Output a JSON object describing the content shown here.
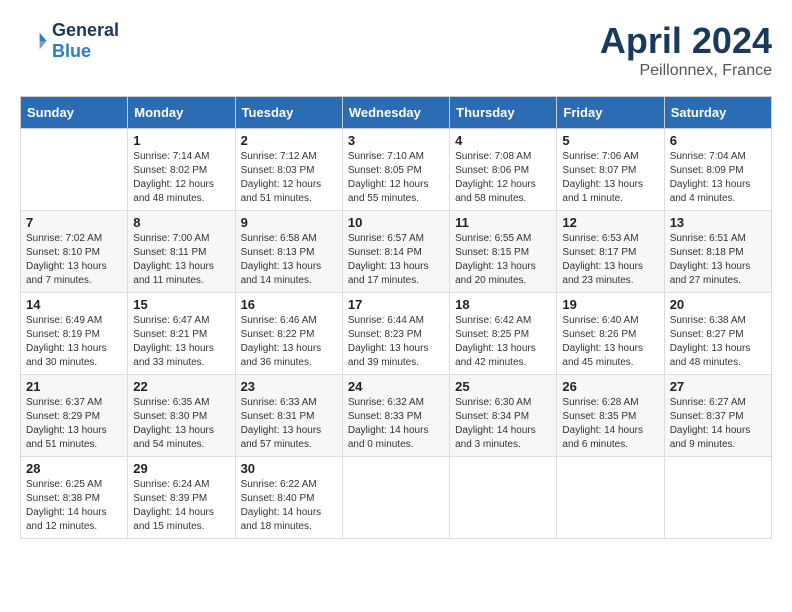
{
  "header": {
    "logo_line1": "General",
    "logo_line2": "Blue",
    "month_title": "April 2024",
    "location": "Peillonnex, France"
  },
  "days_of_week": [
    "Sunday",
    "Monday",
    "Tuesday",
    "Wednesday",
    "Thursday",
    "Friday",
    "Saturday"
  ],
  "weeks": [
    [
      {
        "day": "",
        "sunrise": "",
        "sunset": "",
        "daylight": ""
      },
      {
        "day": "1",
        "sunrise": "Sunrise: 7:14 AM",
        "sunset": "Sunset: 8:02 PM",
        "daylight": "Daylight: 12 hours and 48 minutes."
      },
      {
        "day": "2",
        "sunrise": "Sunrise: 7:12 AM",
        "sunset": "Sunset: 8:03 PM",
        "daylight": "Daylight: 12 hours and 51 minutes."
      },
      {
        "day": "3",
        "sunrise": "Sunrise: 7:10 AM",
        "sunset": "Sunset: 8:05 PM",
        "daylight": "Daylight: 12 hours and 55 minutes."
      },
      {
        "day": "4",
        "sunrise": "Sunrise: 7:08 AM",
        "sunset": "Sunset: 8:06 PM",
        "daylight": "Daylight: 12 hours and 58 minutes."
      },
      {
        "day": "5",
        "sunrise": "Sunrise: 7:06 AM",
        "sunset": "Sunset: 8:07 PM",
        "daylight": "Daylight: 13 hours and 1 minute."
      },
      {
        "day": "6",
        "sunrise": "Sunrise: 7:04 AM",
        "sunset": "Sunset: 8:09 PM",
        "daylight": "Daylight: 13 hours and 4 minutes."
      }
    ],
    [
      {
        "day": "7",
        "sunrise": "Sunrise: 7:02 AM",
        "sunset": "Sunset: 8:10 PM",
        "daylight": "Daylight: 13 hours and 7 minutes."
      },
      {
        "day": "8",
        "sunrise": "Sunrise: 7:00 AM",
        "sunset": "Sunset: 8:11 PM",
        "daylight": "Daylight: 13 hours and 11 minutes."
      },
      {
        "day": "9",
        "sunrise": "Sunrise: 6:58 AM",
        "sunset": "Sunset: 8:13 PM",
        "daylight": "Daylight: 13 hours and 14 minutes."
      },
      {
        "day": "10",
        "sunrise": "Sunrise: 6:57 AM",
        "sunset": "Sunset: 8:14 PM",
        "daylight": "Daylight: 13 hours and 17 minutes."
      },
      {
        "day": "11",
        "sunrise": "Sunrise: 6:55 AM",
        "sunset": "Sunset: 8:15 PM",
        "daylight": "Daylight: 13 hours and 20 minutes."
      },
      {
        "day": "12",
        "sunrise": "Sunrise: 6:53 AM",
        "sunset": "Sunset: 8:17 PM",
        "daylight": "Daylight: 13 hours and 23 minutes."
      },
      {
        "day": "13",
        "sunrise": "Sunrise: 6:51 AM",
        "sunset": "Sunset: 8:18 PM",
        "daylight": "Daylight: 13 hours and 27 minutes."
      }
    ],
    [
      {
        "day": "14",
        "sunrise": "Sunrise: 6:49 AM",
        "sunset": "Sunset: 8:19 PM",
        "daylight": "Daylight: 13 hours and 30 minutes."
      },
      {
        "day": "15",
        "sunrise": "Sunrise: 6:47 AM",
        "sunset": "Sunset: 8:21 PM",
        "daylight": "Daylight: 13 hours and 33 minutes."
      },
      {
        "day": "16",
        "sunrise": "Sunrise: 6:46 AM",
        "sunset": "Sunset: 8:22 PM",
        "daylight": "Daylight: 13 hours and 36 minutes."
      },
      {
        "day": "17",
        "sunrise": "Sunrise: 6:44 AM",
        "sunset": "Sunset: 8:23 PM",
        "daylight": "Daylight: 13 hours and 39 minutes."
      },
      {
        "day": "18",
        "sunrise": "Sunrise: 6:42 AM",
        "sunset": "Sunset: 8:25 PM",
        "daylight": "Daylight: 13 hours and 42 minutes."
      },
      {
        "day": "19",
        "sunrise": "Sunrise: 6:40 AM",
        "sunset": "Sunset: 8:26 PM",
        "daylight": "Daylight: 13 hours and 45 minutes."
      },
      {
        "day": "20",
        "sunrise": "Sunrise: 6:38 AM",
        "sunset": "Sunset: 8:27 PM",
        "daylight": "Daylight: 13 hours and 48 minutes."
      }
    ],
    [
      {
        "day": "21",
        "sunrise": "Sunrise: 6:37 AM",
        "sunset": "Sunset: 8:29 PM",
        "daylight": "Daylight: 13 hours and 51 minutes."
      },
      {
        "day": "22",
        "sunrise": "Sunrise: 6:35 AM",
        "sunset": "Sunset: 8:30 PM",
        "daylight": "Daylight: 13 hours and 54 minutes."
      },
      {
        "day": "23",
        "sunrise": "Sunrise: 6:33 AM",
        "sunset": "Sunset: 8:31 PM",
        "daylight": "Daylight: 13 hours and 57 minutes."
      },
      {
        "day": "24",
        "sunrise": "Sunrise: 6:32 AM",
        "sunset": "Sunset: 8:33 PM",
        "daylight": "Daylight: 14 hours and 0 minutes."
      },
      {
        "day": "25",
        "sunrise": "Sunrise: 6:30 AM",
        "sunset": "Sunset: 8:34 PM",
        "daylight": "Daylight: 14 hours and 3 minutes."
      },
      {
        "day": "26",
        "sunrise": "Sunrise: 6:28 AM",
        "sunset": "Sunset: 8:35 PM",
        "daylight": "Daylight: 14 hours and 6 minutes."
      },
      {
        "day": "27",
        "sunrise": "Sunrise: 6:27 AM",
        "sunset": "Sunset: 8:37 PM",
        "daylight": "Daylight: 14 hours and 9 minutes."
      }
    ],
    [
      {
        "day": "28",
        "sunrise": "Sunrise: 6:25 AM",
        "sunset": "Sunset: 8:38 PM",
        "daylight": "Daylight: 14 hours and 12 minutes."
      },
      {
        "day": "29",
        "sunrise": "Sunrise: 6:24 AM",
        "sunset": "Sunset: 8:39 PM",
        "daylight": "Daylight: 14 hours and 15 minutes."
      },
      {
        "day": "30",
        "sunrise": "Sunrise: 6:22 AM",
        "sunset": "Sunset: 8:40 PM",
        "daylight": "Daylight: 14 hours and 18 minutes."
      },
      {
        "day": "",
        "sunrise": "",
        "sunset": "",
        "daylight": ""
      },
      {
        "day": "",
        "sunrise": "",
        "sunset": "",
        "daylight": ""
      },
      {
        "day": "",
        "sunrise": "",
        "sunset": "",
        "daylight": ""
      },
      {
        "day": "",
        "sunrise": "",
        "sunset": "",
        "daylight": ""
      }
    ]
  ]
}
